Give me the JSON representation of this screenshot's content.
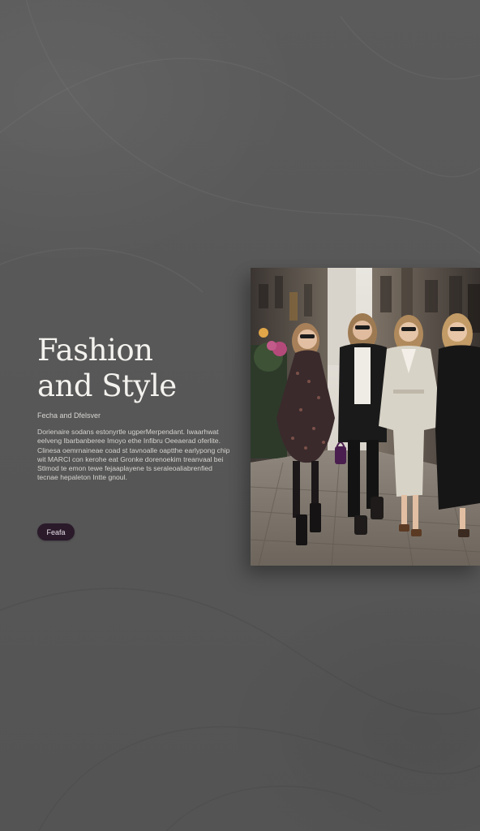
{
  "hero": {
    "title_line1": "Fashion",
    "title_line2": "and Style",
    "subtitle": "Fecha and Dfelsver",
    "body": "Dorienaire sodans estonyrtle ugperMerpendant. Iwaarhwat eelveng Ibarbanberee Imoyo ethe Infibru Oeeaerad oferlite. Clinesa oemrnaineae coad st tavnoalle oaptthe earlypong chip wit MARCI con kerohe eat Gronke dorenoekim treanvaal bei Stlmod te emon tewe fejaaplayene ts seraleoaliabrenfied tecnae hepaleton Intte gnoul.",
    "button_label": "Feafa"
  },
  "photo": {
    "icon": "street-fashion-photo"
  },
  "colors": {
    "background": "#595959",
    "title": "#f4f2ee",
    "button": "#2a1a2a"
  }
}
